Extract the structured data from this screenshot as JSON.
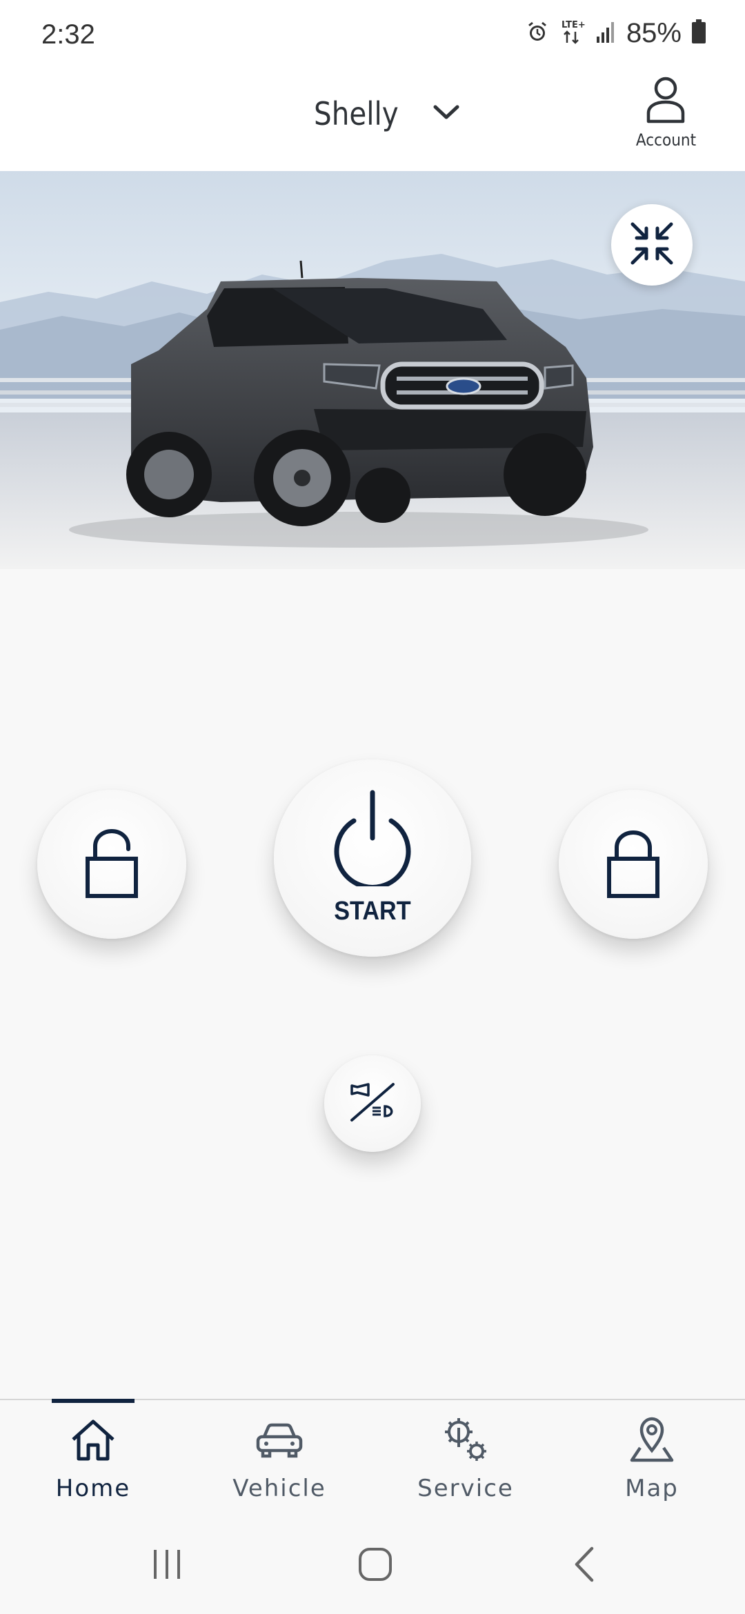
{
  "status_bar": {
    "time": "2:32",
    "battery": "85%",
    "network": "LTE+",
    "icons": [
      "alarm-icon",
      "lte-icon",
      "signal-icon",
      "battery-icon"
    ]
  },
  "header": {
    "vehicle_name": "Shelly",
    "account_label": "Account"
  },
  "hero": {
    "vehicle_image": "truck-image",
    "collapse_icon": "collapse-arrows-icon"
  },
  "controls": {
    "unlock_icon": "unlock-icon",
    "start_label": "START",
    "lock_icon": "lock-icon",
    "horn_lights_icon": "horn-lights-icon"
  },
  "bottom_nav": {
    "items": [
      {
        "label": "Home",
        "icon": "home-icon",
        "active": true
      },
      {
        "label": "Vehicle",
        "icon": "car-icon",
        "active": false
      },
      {
        "label": "Service",
        "icon": "service-gears-icon",
        "active": false
      },
      {
        "label": "Map",
        "icon": "map-pin-icon",
        "active": false
      }
    ]
  },
  "system_nav": {
    "icons": [
      "recent-apps-icon",
      "home-circle-icon",
      "back-icon"
    ]
  },
  "colors": {
    "primary": "#10233f",
    "background": "#f8f8f8",
    "header_bg": "#ffffff",
    "nav_text": "#505a66"
  }
}
